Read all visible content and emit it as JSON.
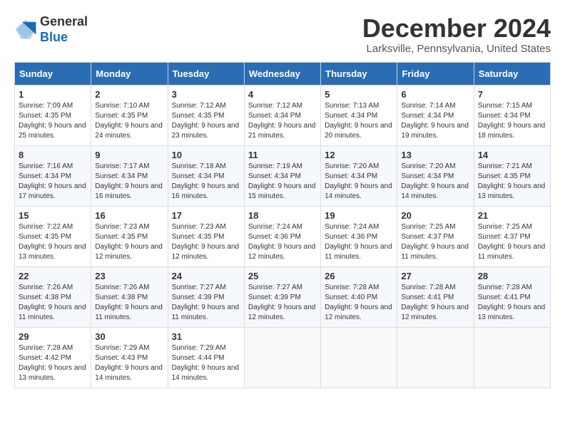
{
  "logo": {
    "line1": "General",
    "line2": "Blue"
  },
  "title": "December 2024",
  "location": "Larksville, Pennsylvania, United States",
  "days_of_week": [
    "Sunday",
    "Monday",
    "Tuesday",
    "Wednesday",
    "Thursday",
    "Friday",
    "Saturday"
  ],
  "weeks": [
    [
      {
        "day": "1",
        "sunrise": "7:09 AM",
        "sunset": "4:35 PM",
        "daylight": "9 hours and 25 minutes."
      },
      {
        "day": "2",
        "sunrise": "7:10 AM",
        "sunset": "4:35 PM",
        "daylight": "9 hours and 24 minutes."
      },
      {
        "day": "3",
        "sunrise": "7:12 AM",
        "sunset": "4:35 PM",
        "daylight": "9 hours and 23 minutes."
      },
      {
        "day": "4",
        "sunrise": "7:12 AM",
        "sunset": "4:34 PM",
        "daylight": "9 hours and 21 minutes."
      },
      {
        "day": "5",
        "sunrise": "7:13 AM",
        "sunset": "4:34 PM",
        "daylight": "9 hours and 20 minutes."
      },
      {
        "day": "6",
        "sunrise": "7:14 AM",
        "sunset": "4:34 PM",
        "daylight": "9 hours and 19 minutes."
      },
      {
        "day": "7",
        "sunrise": "7:15 AM",
        "sunset": "4:34 PM",
        "daylight": "9 hours and 18 minutes."
      }
    ],
    [
      {
        "day": "8",
        "sunrise": "7:16 AM",
        "sunset": "4:34 PM",
        "daylight": "9 hours and 17 minutes."
      },
      {
        "day": "9",
        "sunrise": "7:17 AM",
        "sunset": "4:34 PM",
        "daylight": "9 hours and 16 minutes."
      },
      {
        "day": "10",
        "sunrise": "7:18 AM",
        "sunset": "4:34 PM",
        "daylight": "9 hours and 16 minutes."
      },
      {
        "day": "11",
        "sunrise": "7:19 AM",
        "sunset": "4:34 PM",
        "daylight": "9 hours and 15 minutes."
      },
      {
        "day": "12",
        "sunrise": "7:20 AM",
        "sunset": "4:34 PM",
        "daylight": "9 hours and 14 minutes."
      },
      {
        "day": "13",
        "sunrise": "7:20 AM",
        "sunset": "4:34 PM",
        "daylight": "9 hours and 14 minutes."
      },
      {
        "day": "14",
        "sunrise": "7:21 AM",
        "sunset": "4:35 PM",
        "daylight": "9 hours and 13 minutes."
      }
    ],
    [
      {
        "day": "15",
        "sunrise": "7:22 AM",
        "sunset": "4:35 PM",
        "daylight": "9 hours and 13 minutes."
      },
      {
        "day": "16",
        "sunrise": "7:23 AM",
        "sunset": "4:35 PM",
        "daylight": "9 hours and 12 minutes."
      },
      {
        "day": "17",
        "sunrise": "7:23 AM",
        "sunset": "4:35 PM",
        "daylight": "9 hours and 12 minutes."
      },
      {
        "day": "18",
        "sunrise": "7:24 AM",
        "sunset": "4:36 PM",
        "daylight": "9 hours and 12 minutes."
      },
      {
        "day": "19",
        "sunrise": "7:24 AM",
        "sunset": "4:36 PM",
        "daylight": "9 hours and 11 minutes."
      },
      {
        "day": "20",
        "sunrise": "7:25 AM",
        "sunset": "4:37 PM",
        "daylight": "9 hours and 11 minutes."
      },
      {
        "day": "21",
        "sunrise": "7:25 AM",
        "sunset": "4:37 PM",
        "daylight": "9 hours and 11 minutes."
      }
    ],
    [
      {
        "day": "22",
        "sunrise": "7:26 AM",
        "sunset": "4:38 PM",
        "daylight": "9 hours and 11 minutes."
      },
      {
        "day": "23",
        "sunrise": "7:26 AM",
        "sunset": "4:38 PM",
        "daylight": "9 hours and 11 minutes."
      },
      {
        "day": "24",
        "sunrise": "7:27 AM",
        "sunset": "4:39 PM",
        "daylight": "9 hours and 11 minutes."
      },
      {
        "day": "25",
        "sunrise": "7:27 AM",
        "sunset": "4:39 PM",
        "daylight": "9 hours and 12 minutes."
      },
      {
        "day": "26",
        "sunrise": "7:28 AM",
        "sunset": "4:40 PM",
        "daylight": "9 hours and 12 minutes."
      },
      {
        "day": "27",
        "sunrise": "7:28 AM",
        "sunset": "4:41 PM",
        "daylight": "9 hours and 12 minutes."
      },
      {
        "day": "28",
        "sunrise": "7:28 AM",
        "sunset": "4:41 PM",
        "daylight": "9 hours and 13 minutes."
      }
    ],
    [
      {
        "day": "29",
        "sunrise": "7:28 AM",
        "sunset": "4:42 PM",
        "daylight": "9 hours and 13 minutes."
      },
      {
        "day": "30",
        "sunrise": "7:29 AM",
        "sunset": "4:43 PM",
        "daylight": "9 hours and 14 minutes."
      },
      {
        "day": "31",
        "sunrise": "7:29 AM",
        "sunset": "4:44 PM",
        "daylight": "9 hours and 14 minutes."
      },
      null,
      null,
      null,
      null
    ]
  ],
  "labels": {
    "sunrise": "Sunrise:",
    "sunset": "Sunset:",
    "daylight": "Daylight:"
  }
}
